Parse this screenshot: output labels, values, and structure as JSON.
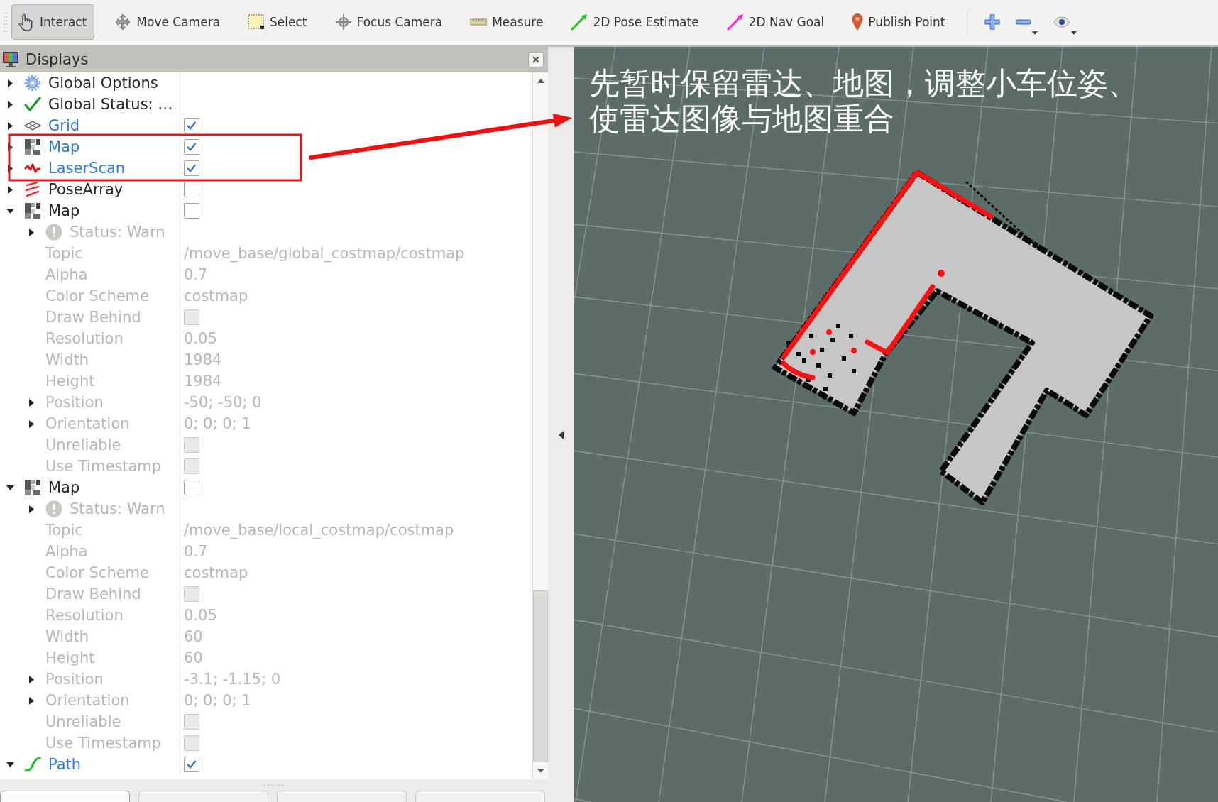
{
  "toolbar": {
    "tools": [
      {
        "kind": "interact",
        "label": "Interact",
        "selected": true
      },
      {
        "kind": "move_camera",
        "label": "Move Camera",
        "selected": false
      },
      {
        "kind": "select",
        "label": "Select",
        "selected": false
      },
      {
        "kind": "focus_camera",
        "label": "Focus Camera",
        "selected": false
      },
      {
        "kind": "measure",
        "label": "Measure",
        "selected": false
      },
      {
        "kind": "pose_estimate",
        "label": "2D Pose Estimate",
        "selected": false
      },
      {
        "kind": "nav_goal",
        "label": "2D Nav Goal",
        "selected": false
      },
      {
        "kind": "publish_point",
        "label": "Publish Point",
        "selected": false
      }
    ],
    "actions": [
      {
        "kind": "add",
        "has_menu": false
      },
      {
        "kind": "remove",
        "has_menu": true
      },
      {
        "kind": "view",
        "has_menu": true
      }
    ]
  },
  "displays_panel": {
    "title": "Displays",
    "items": [
      {
        "kind": "options",
        "label": "Global Options",
        "expanded": false,
        "highlighted": false
      },
      {
        "kind": "status_ok",
        "label": "Global Status: …",
        "expanded": false,
        "highlighted": false
      },
      {
        "kind": "grid",
        "label": "Grid",
        "expanded": false,
        "checked": true,
        "highlighted": false
      },
      {
        "kind": "map",
        "label": "Map",
        "expanded": false,
        "checked": true,
        "highlighted": true
      },
      {
        "kind": "laser_scan",
        "label": "LaserScan",
        "expanded": false,
        "checked": true,
        "highlighted": true
      },
      {
        "kind": "pose_array",
        "label": "PoseArray",
        "expanded": false,
        "checked": false,
        "highlighted": false
      },
      {
        "kind": "map",
        "label": "Map",
        "expanded": true,
        "checked": false,
        "highlighted": false,
        "children": [
          {
            "kind": "status_warn",
            "label": "Status: Warn",
            "expanded": false
          },
          {
            "kind": "property",
            "label": "Topic",
            "value": "/move_base/global_costmap/costmap"
          },
          {
            "kind": "property",
            "label": "Alpha",
            "value": "0.7"
          },
          {
            "kind": "property",
            "label": "Color Scheme",
            "value": "costmap"
          },
          {
            "kind": "property",
            "label": "Draw Behind",
            "checked": false
          },
          {
            "kind": "property",
            "label": "Resolution",
            "value": "0.05"
          },
          {
            "kind": "property",
            "label": "Width",
            "value": "1984"
          },
          {
            "kind": "property",
            "label": "Height",
            "value": "1984"
          },
          {
            "kind": "property",
            "label": "Position",
            "value": "-50; -50; 0",
            "expanded": false
          },
          {
            "kind": "property",
            "label": "Orientation",
            "value": "0; 0; 0; 1",
            "expanded": false
          },
          {
            "kind": "property",
            "label": "Unreliable",
            "checked": false
          },
          {
            "kind": "property",
            "label": "Use Timestamp",
            "checked": false
          }
        ]
      },
      {
        "kind": "map",
        "label": "Map",
        "expanded": true,
        "checked": false,
        "highlighted": false,
        "children": [
          {
            "kind": "status_warn",
            "label": "Status: Warn",
            "expanded": false
          },
          {
            "kind": "property",
            "label": "Topic",
            "value": "/move_base/local_costmap/costmap"
          },
          {
            "kind": "property",
            "label": "Alpha",
            "value": "0.7"
          },
          {
            "kind": "property",
            "label": "Color Scheme",
            "value": "costmap"
          },
          {
            "kind": "property",
            "label": "Draw Behind",
            "checked": false
          },
          {
            "kind": "property",
            "label": "Resolution",
            "value": "0.05"
          },
          {
            "kind": "property",
            "label": "Width",
            "value": "60"
          },
          {
            "kind": "property",
            "label": "Height",
            "value": "60"
          },
          {
            "kind": "property",
            "label": "Position",
            "value": "-3.1; -1.15; 0",
            "expanded": false
          },
          {
            "kind": "property",
            "label": "Orientation",
            "value": "0; 0; 0; 1",
            "expanded": false
          },
          {
            "kind": "property",
            "label": "Unreliable",
            "checked": false
          },
          {
            "kind": "property",
            "label": "Use Timestamp",
            "checked": false
          }
        ]
      },
      {
        "kind": "path",
        "label": "Path",
        "expanded": true,
        "checked": true,
        "highlighted": false
      }
    ],
    "buttons": [
      {
        "disabled": false
      },
      {
        "disabled": true
      },
      {
        "disabled": true
      },
      {
        "disabled": true
      }
    ]
  },
  "view": {
    "annotation_lines": [
      "先暂时保留雷达、地图，调整小车位姿、",
      "使雷达图像与地图重合"
    ]
  }
}
